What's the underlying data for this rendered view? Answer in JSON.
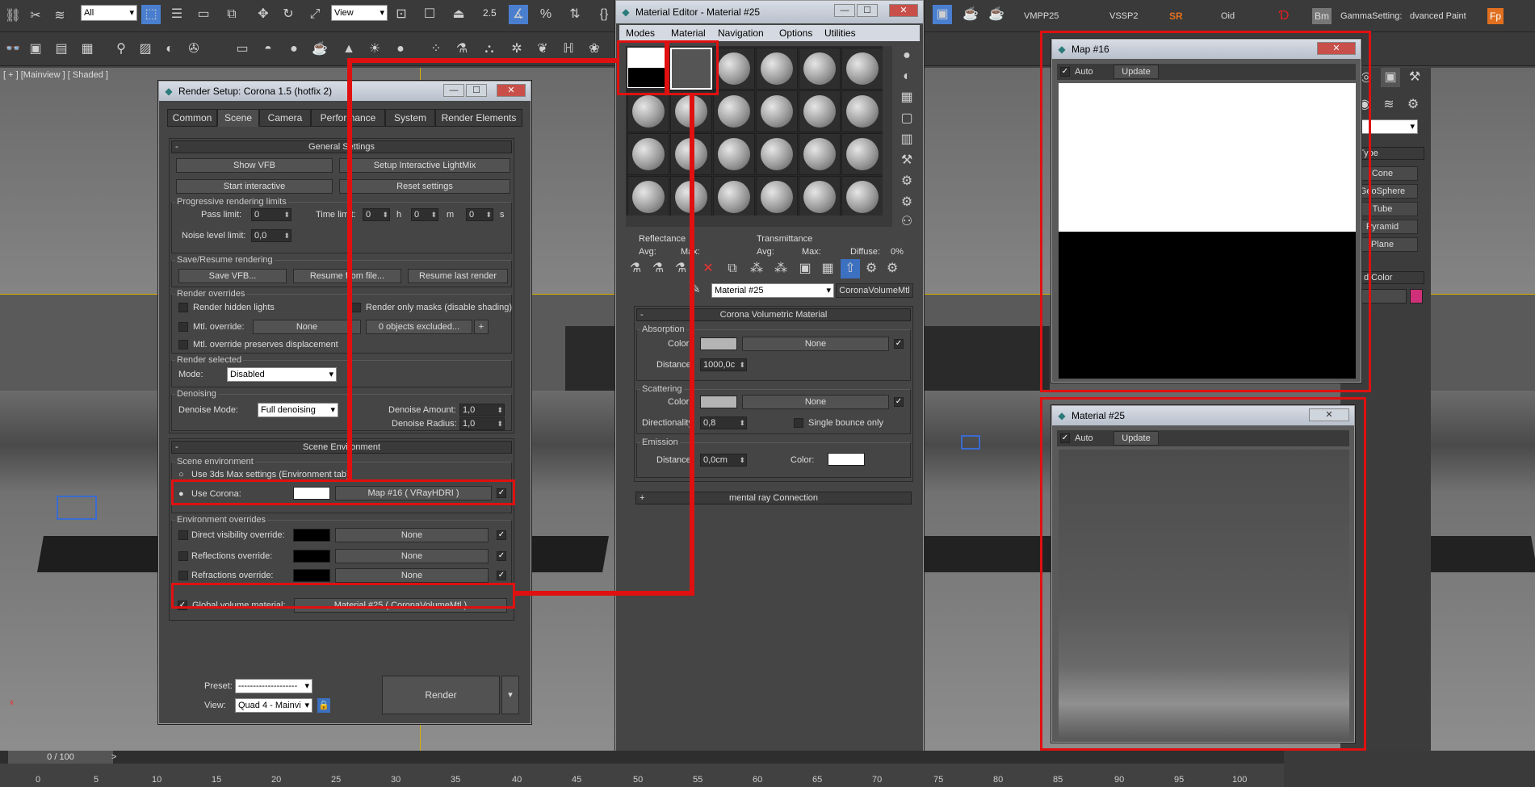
{
  "toolbar": {
    "selection_filter": "All",
    "reference_coord": "View",
    "snap_value": "2.5",
    "right_buttons": [
      "VMPP25",
      "VSSP2",
      "SR",
      "Oid",
      "Bm",
      "GammaSetting:",
      "dvanced Paint",
      "Fp"
    ]
  },
  "viewport": {
    "label": "[ + ] [Mainview ] [ Shaded ]"
  },
  "render_setup": {
    "title": "Render Setup: Corona 1.5 (hotfix 2)",
    "tabs": [
      "Common",
      "Scene",
      "Camera",
      "Performance",
      "System",
      "Render Elements"
    ],
    "active_tab": "Scene",
    "general_settings": {
      "header": "General Settings",
      "show_vfb": "Show VFB",
      "setup_lightmix": "Setup Interactive LightMix",
      "start_interactive": "Start interactive",
      "reset_settings": "Reset settings",
      "progressive_label": "Progressive rendering limits",
      "pass_limit_label": "Pass limit:",
      "pass_limit": "0",
      "time_limit_label": "Time limit:",
      "time_h": "0",
      "h": "h",
      "time_m": "0",
      "m": "m",
      "time_s": "0",
      "s": "s",
      "noise_label": "Noise level limit:",
      "noise_value": "0,0",
      "save_resume_label": "Save/Resume rendering",
      "save_vfb": "Save VFB...",
      "resume_file": "Resume from file...",
      "resume_last": "Resume last render",
      "overrides_label": "Render overrides",
      "hidden_lights": "Render hidden lights",
      "only_masks": "Render only masks (disable shading)",
      "mtl_override": "Mtl. override:",
      "mtl_none": "None",
      "objects_excluded": "0 objects excluded...",
      "plus": "+",
      "preserves_disp": "Mtl. override preserves displacement",
      "render_selected_label": "Render selected",
      "mode_label": "Mode:",
      "mode_value": "Disabled",
      "denoising_label": "Denoising",
      "denoise_mode_label": "Denoise Mode:",
      "denoise_mode_value": "Full denoising",
      "denoise_amount_label": "Denoise Amount:",
      "denoise_amount": "1,0",
      "denoise_radius_label": "Denoise Radius:",
      "denoise_radius": "1,0"
    },
    "scene_environment": {
      "header": "Scene Environment",
      "group_label": "Scene environment",
      "use_3ds": "Use 3ds Max settings (Environment tab)",
      "use_corona": "Use Corona:",
      "env_map": "Map #16  ( VRayHDRI )",
      "overrides_label": "Environment overrides",
      "direct_vis": "Direct visibility override:",
      "reflections": "Reflections override:",
      "refractions": "Refractions override:",
      "none": "None",
      "global_volume": "Global volume material:",
      "global_volume_mtl": "Material #25  ( CoronaVolumeMtl )"
    },
    "footer": {
      "preset_label": "Preset:",
      "preset_value": "--------------------",
      "view_label": "View:",
      "view_value": "Quad 4 - Mainvi",
      "render_button": "Render"
    }
  },
  "material_editor": {
    "title": "Material Editor - Material #25",
    "menus": [
      "Modes",
      "Material",
      "Navigation",
      "Options",
      "Utilities"
    ],
    "reflectance": "Reflectance",
    "transmittance": "Transmittance",
    "avg": "Avg:",
    "max": "Max:",
    "avg2": "Avg:",
    "max2": "Max:",
    "diffuse": "Diffuse:",
    "diffuse_val": "0%",
    "material_name": "Material #25",
    "material_type": "CoronaVolumeMtl",
    "volumetric_header": "Corona Volumetric Material",
    "absorption_label": "Absorption",
    "color_label": "Color:",
    "none": "None",
    "distance_label": "Distance:",
    "abs_distance": "1000,0c",
    "scattering_label": "Scattering",
    "scat_color_label": "Color:",
    "directionality_label": "Directionality:",
    "directionality": "0,8",
    "single_bounce": "Single bounce only",
    "emission_label": "Emission",
    "emi_distance_label": "Distance:",
    "emi_distance": "0,0cm",
    "emi_color_label": "Color:",
    "mental_ray": "mental ray Connection",
    "plus": "+"
  },
  "map16_window": {
    "title": "Map #16",
    "auto": "Auto",
    "update": "Update"
  },
  "mat25_window": {
    "title": "Material #25",
    "auto": "Auto",
    "update": "Update"
  },
  "command_panel": {
    "type_label": "Type",
    "buttons": [
      "Cone",
      "GeoSphere",
      "Tube",
      "Pyramid",
      "Plane"
    ],
    "color_label": "d Color"
  },
  "timeline": {
    "frame": "0 / 100",
    "ticks": [
      "0",
      "5",
      "10",
      "15",
      "20",
      "25",
      "30",
      "35",
      "40",
      "45",
      "50",
      "55",
      "60",
      "65",
      "70",
      "75",
      "80",
      "85",
      "90",
      "95",
      "100"
    ]
  },
  "colors": {
    "accent_red": "#e01010",
    "swatch_pink": "#d0307a"
  }
}
